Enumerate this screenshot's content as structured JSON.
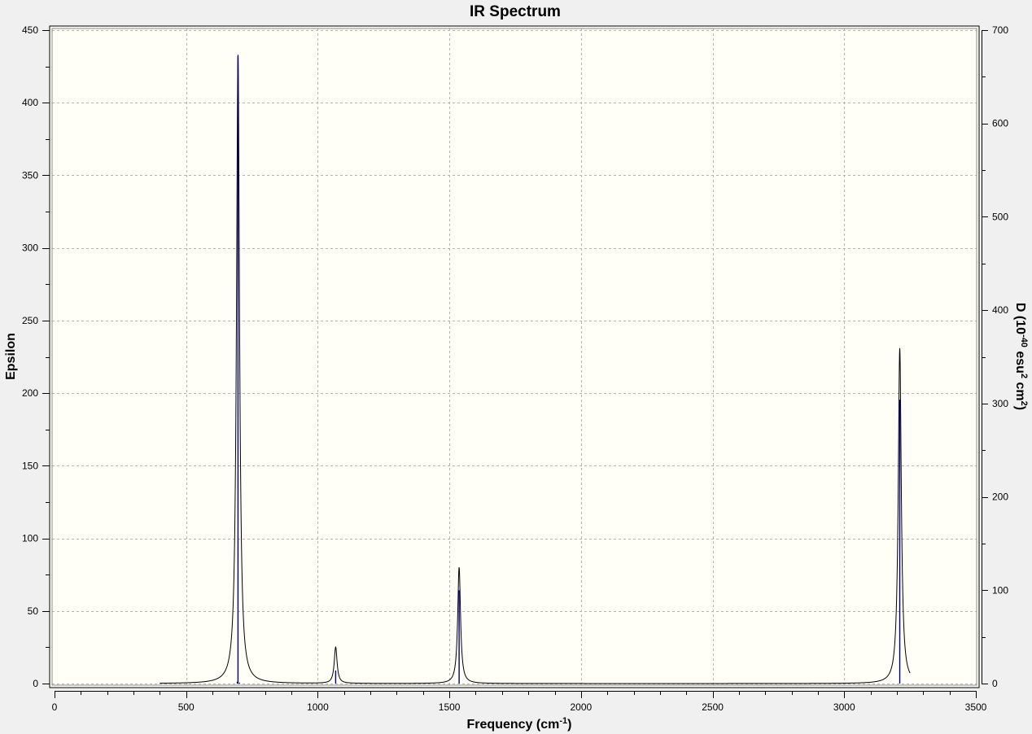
{
  "chart_data": {
    "type": "line",
    "title": "IR Spectrum",
    "xlabel": {
      "text": "Frequency (cm",
      "sup": "-1",
      "end": ")"
    },
    "ylabel_left": "Epsilon",
    "ylabel_right": {
      "base": "D (10",
      "sup1": "-40",
      "mid": " esu",
      "sup2": "2",
      "mid2": " cm",
      "sup3": "2",
      "end": ")"
    },
    "xlim": [
      0,
      3500
    ],
    "ylim_left": [
      0,
      450
    ],
    "ylim_right": [
      0,
      700
    ],
    "x_ticks": [
      0,
      500,
      1000,
      1500,
      2000,
      2500,
      3000,
      3500
    ],
    "y_ticks_left": [
      0,
      50,
      100,
      150,
      200,
      250,
      300,
      350,
      400,
      450
    ],
    "y_ticks_right": [
      0,
      100,
      200,
      300,
      400,
      500,
      600,
      700
    ],
    "grid": true,
    "spectrum_range": [
      400,
      3250
    ],
    "line_color": "#000000",
    "stick_color": "#00007f",
    "peaks": [
      {
        "x": 697,
        "epsilon": 433,
        "width": 14,
        "stick_d": 672
      },
      {
        "x": 1068,
        "epsilon": 25,
        "width": 13,
        "stick_d": 14
      },
      {
        "x": 1537,
        "epsilon": 80,
        "width": 13,
        "stick_d": 100
      },
      {
        "x": 3211,
        "epsilon": 231,
        "width": 14,
        "stick_d": 304
      }
    ],
    "tiny_sticks_d": [
      {
        "x": 694,
        "d": 2
      },
      {
        "x": 703,
        "d": 1
      }
    ]
  },
  "colors": {
    "plot_background": "#fffff8",
    "window_background": "#f0f0f0",
    "grid": "#b4b4b4"
  }
}
